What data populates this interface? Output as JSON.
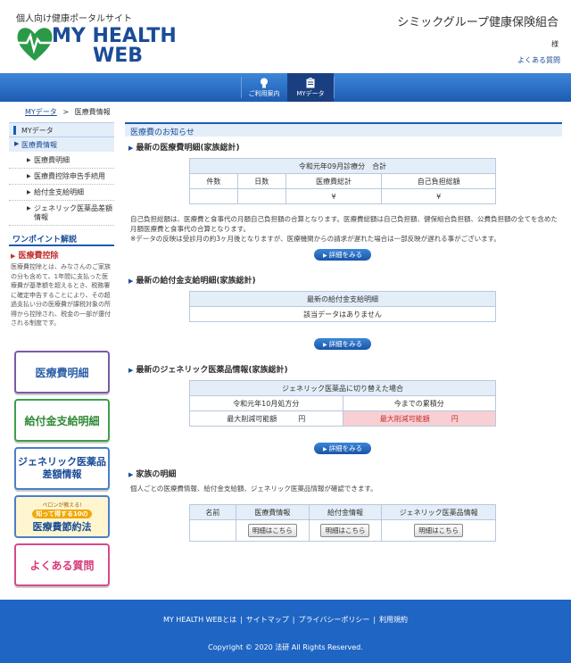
{
  "header": {
    "tagline": "個人向け健康ポータルサイト",
    "logo_line1": "MY HEALTH",
    "logo_line2": "WEB",
    "org_name": "シミックグループ健康保険組合",
    "honorific": "様",
    "faq_link": "よくある質問"
  },
  "nav": {
    "items": [
      {
        "label": "ご利用案内",
        "icon": "lightbulb-icon"
      },
      {
        "label": "MYデータ",
        "icon": "clipboard-icon"
      }
    ],
    "active": "MYデータ"
  },
  "breadcrumb": {
    "home": "MYデータ",
    "sep": ">",
    "current": "医療費情報"
  },
  "sidebar": {
    "head": "MYデータ",
    "sub": "医療費情報",
    "items": [
      "医療費明細",
      "医療費控除申告手続用",
      "給付金支給明細",
      "ジェネリック医薬品差額情報"
    ],
    "tip_head": "ワンポイント解説",
    "tip_title": "医療費控除",
    "tip_body": "医療費控除とは、みなさんのご家族の分も含めて、1年間に支払った医療費が基準額を超えるとき、税務署に確定申告することにより、その超過支払い分の医療費が課税対象の所得から控除され、税金の一部が還付される制度です。"
  },
  "banners": {
    "b1": "医療費明細",
    "b2": "給付金支給明細",
    "b3_line1": "ジェネリック医薬品",
    "b3_line2": "差額情報",
    "b4_top": "ペロンが教える!",
    "b4_mid": "知って得する10の",
    "b4_main": "医療費節約法",
    "b5": "よくある質問"
  },
  "main": {
    "heading": "医療費のお知らせ",
    "sec1": {
      "title": "最新の医療費明細(家族総計)",
      "table_caption": "令和元年09月診療分　合計",
      "columns": [
        "件数",
        "日数",
        "医療費総計",
        "自己負担総額"
      ],
      "values": [
        "",
        "",
        "¥",
        "¥"
      ],
      "note1": "自己負担総額は、医療費と食事代の月額自己負担額の合算となります。医療費総額は自己負担額、健保組合負担額、公費負担額の全てを含めた月額医療費と食事代の合算となります。",
      "note2": "※データの反映は受診月の約3ヶ月後となりますが、医療機関からの請求が遅れた場合は一部反映が遅れる事がございます。",
      "button": "詳細をみる"
    },
    "sec2": {
      "title": "最新の給付金支給明細(家族総計)",
      "table_caption": "最新の給付金支給明細",
      "empty": "該当データはありません",
      "button": "詳細をみる"
    },
    "sec3": {
      "title": "最新のジェネリック医薬品情報(家族総計)",
      "table_caption": "ジェネリック医薬品に切り替えた場合",
      "col_left": "令和元年10月処方分",
      "col_right": "今までの累積分",
      "val_left": "最大削減可能額　　　円",
      "val_right": "最大削減可能額　　　円",
      "button": "詳細をみる"
    },
    "sec4": {
      "title": "家族の明細",
      "desc": "個人ごとの医療費情報、給付金支給額、ジェネリック医薬品情報が確認できます。",
      "columns": [
        "名前",
        "医療費情報",
        "給付金情報",
        "ジェネリック医薬品情報"
      ],
      "row_button": "明細はこちら"
    }
  },
  "footer": {
    "links": [
      "MY HEALTH WEBとは",
      "サイトマップ",
      "プライバシーポリシー",
      "利用規約"
    ],
    "copyright": "Copyright © 2020 法研 All Rights Reserved."
  }
}
